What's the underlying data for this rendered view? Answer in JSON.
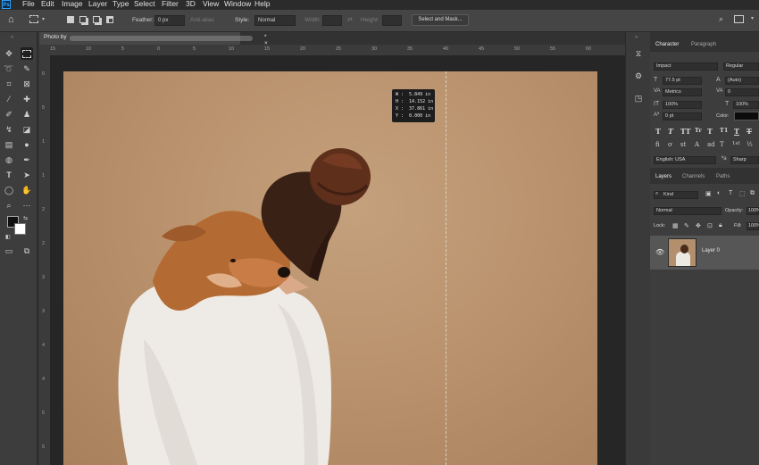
{
  "menu": [
    "File",
    "Edit",
    "Image",
    "Layer",
    "Type",
    "Select",
    "Filter",
    "3D",
    "View",
    "Window",
    "Help"
  ],
  "options": {
    "feather_label": "Feather:",
    "feather_value": "0 px",
    "antialias_label": "Anti-alias",
    "style_label": "Style:",
    "style_value": "Normal",
    "width_label": "Width:",
    "height_label": "Height:",
    "select_mask_label": "Select and Mask..."
  },
  "document": {
    "tab_title": "Photo by",
    "tab_suffix": "* ×"
  },
  "ruler_top": [
    "15",
    "10",
    "5",
    "0",
    "5",
    "10",
    "15",
    "20",
    "25",
    "30",
    "35",
    "40",
    "45",
    "50",
    "55",
    "60"
  ],
  "ruler_left": [
    "0",
    "5",
    "1",
    "1",
    "2",
    "2",
    "3",
    "3",
    "4",
    "4",
    "5",
    "5"
  ],
  "transform_readout": {
    "w": "W :  5.849 in",
    "h": "H :  14.152 in",
    "x": "X :  37.861 in",
    "y": "Y :  0.000 in"
  },
  "character_panel": {
    "tabs": [
      "Character",
      "Paragraph"
    ],
    "font_family": "Impact",
    "font_style": "Regular",
    "font_size": "77.5 pt",
    "leading": "(Auto)",
    "kerning": "Metrics",
    "tracking": "0",
    "vertical_scale": "100%",
    "horizontal_scale": "100%",
    "baseline_shift": "0 pt",
    "color_label": "Color:",
    "type_buttons": [
      "T",
      "T",
      "TT",
      "Tr",
      "T",
      "T1",
      "T",
      "T"
    ],
    "opentype_buttons": [
      "fi",
      "ơ",
      "st",
      "A",
      "ad",
      "T",
      "1st",
      "½"
    ],
    "language": "English: USA",
    "antialias": "Sharp"
  },
  "layers_panel": {
    "tabs": [
      "Layers",
      "Channels",
      "Paths"
    ],
    "filter": "Kind",
    "blend_mode": "Normal",
    "opacity_label": "Opacity:",
    "opacity_value": "100%",
    "lock_label": "Lock:",
    "fill_label": "Fill:",
    "fill_value": "100%",
    "layers": [
      {
        "name": "Layer 0"
      }
    ]
  }
}
